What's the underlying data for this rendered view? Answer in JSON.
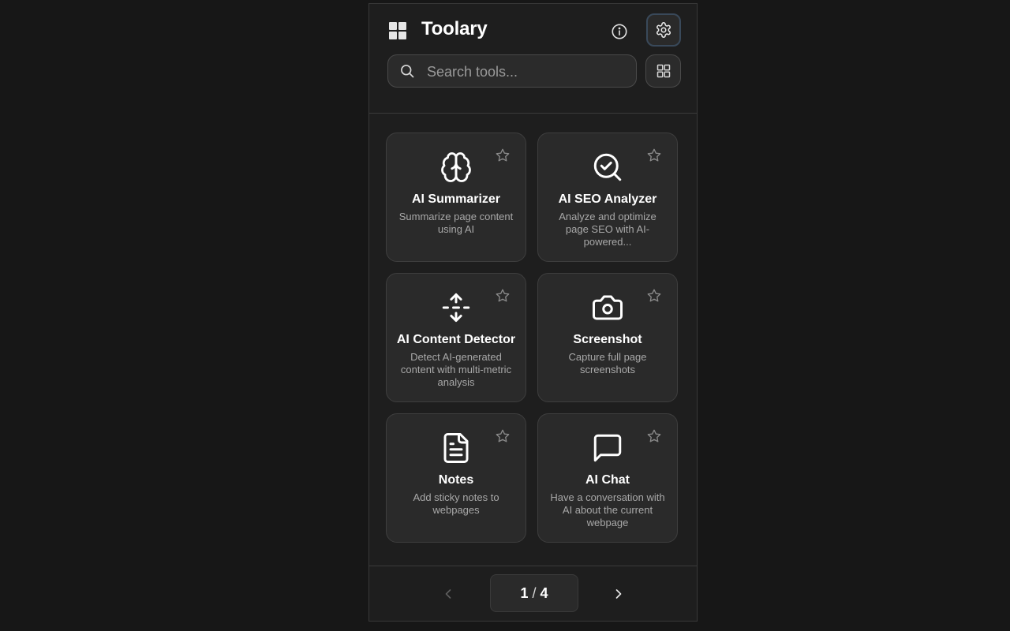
{
  "header": {
    "title": "Toolary",
    "logo_icon": "grid-logo-icon",
    "info_icon": "info-icon",
    "settings_icon": "gear-icon"
  },
  "search": {
    "placeholder": "Search tools...",
    "value": ""
  },
  "tools": [
    {
      "name": "AI Summarizer",
      "description": "Summarize page content using AI",
      "icon": "brain-icon"
    },
    {
      "name": "AI SEO Analyzer",
      "description": "Analyze and optimize page SEO with AI-powered...",
      "icon": "search-check-icon"
    },
    {
      "name": "AI Content Detector",
      "description": "Detect AI-generated content with multi-metric analysis",
      "icon": "split-arrows-icon"
    },
    {
      "name": "Screenshot",
      "description": "Capture full page screenshots",
      "icon": "camera-icon"
    },
    {
      "name": "Notes",
      "description": "Add sticky notes to webpages",
      "icon": "document-icon"
    },
    {
      "name": "AI Chat",
      "description": "Have a conversation with AI about the current webpage",
      "icon": "chat-bubble-icon"
    }
  ],
  "pagination": {
    "current": "1",
    "separator": "/",
    "total": "4"
  },
  "colors": {
    "background": "#171717",
    "panel": "#1e1e1e",
    "card": "#2a2a2a",
    "settings_border": "#39495a"
  }
}
